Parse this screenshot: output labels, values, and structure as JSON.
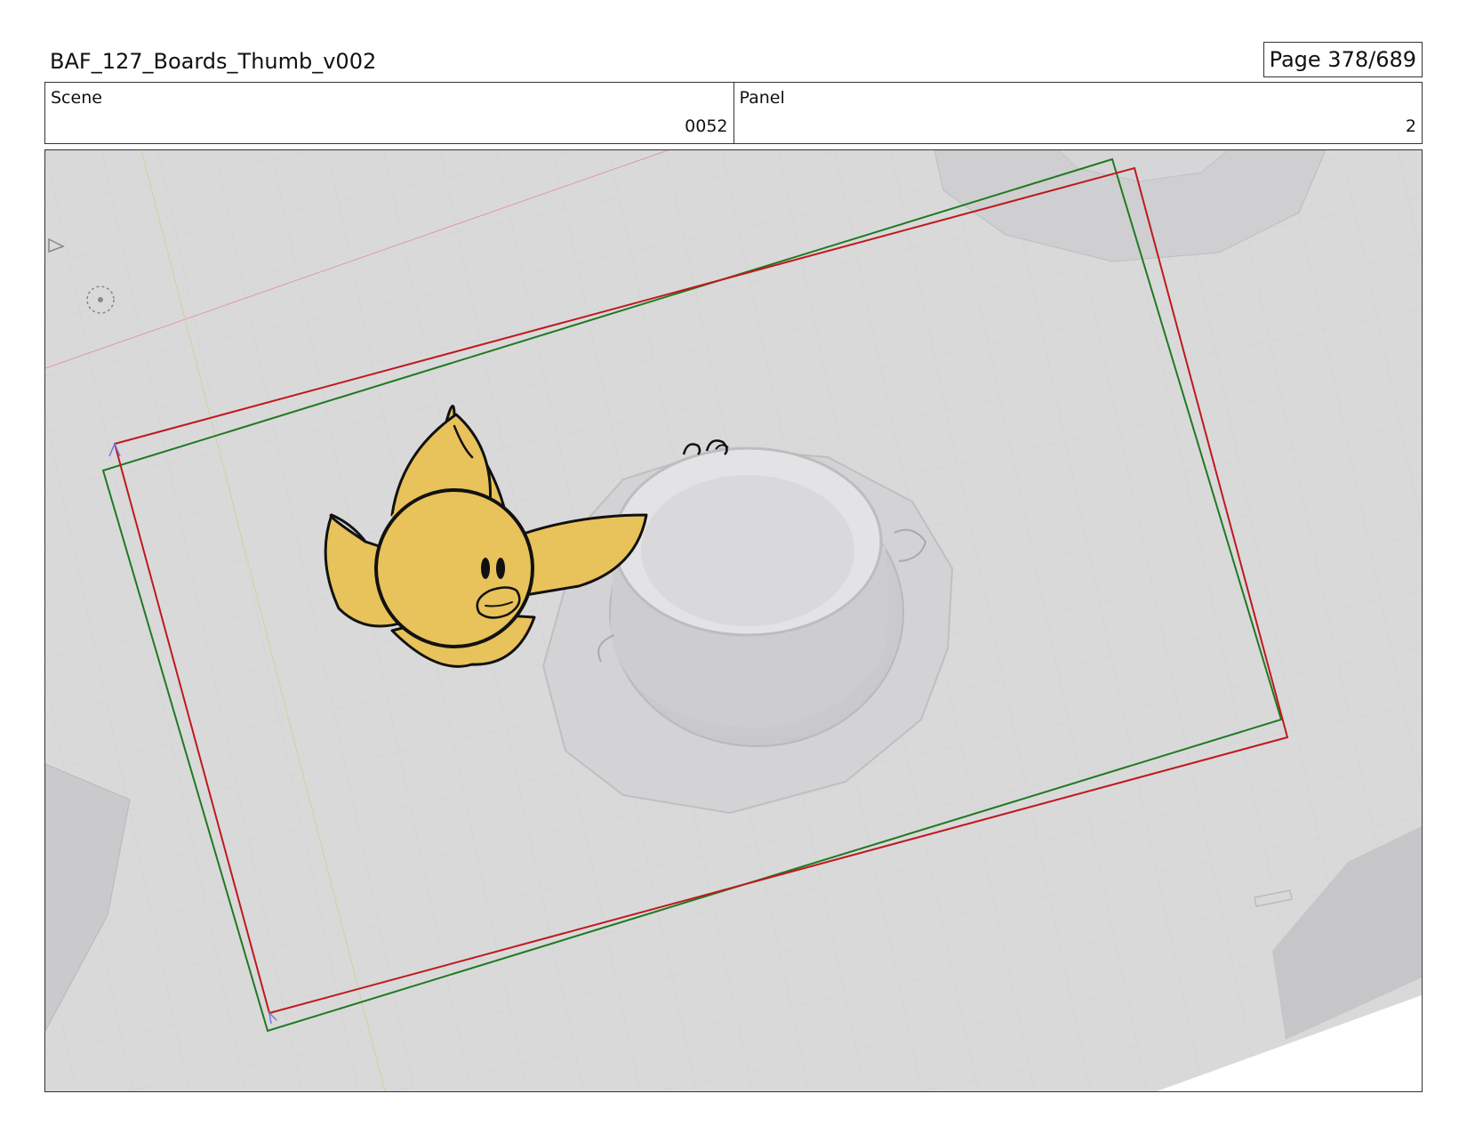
{
  "header": {
    "title": "BAF_127_Boards_Thumb_v002",
    "page_label": "Page 378/689"
  },
  "info": {
    "scene_label": "Scene",
    "scene_value": "0052",
    "panel_label": "Panel",
    "panel_value": "2"
  },
  "frame": {
    "overlay_colors": {
      "guide_green": "#1f7a1f",
      "guide_red": "#c0181d",
      "background": "#d9d9da"
    },
    "character_color": "#e8c25a"
  }
}
